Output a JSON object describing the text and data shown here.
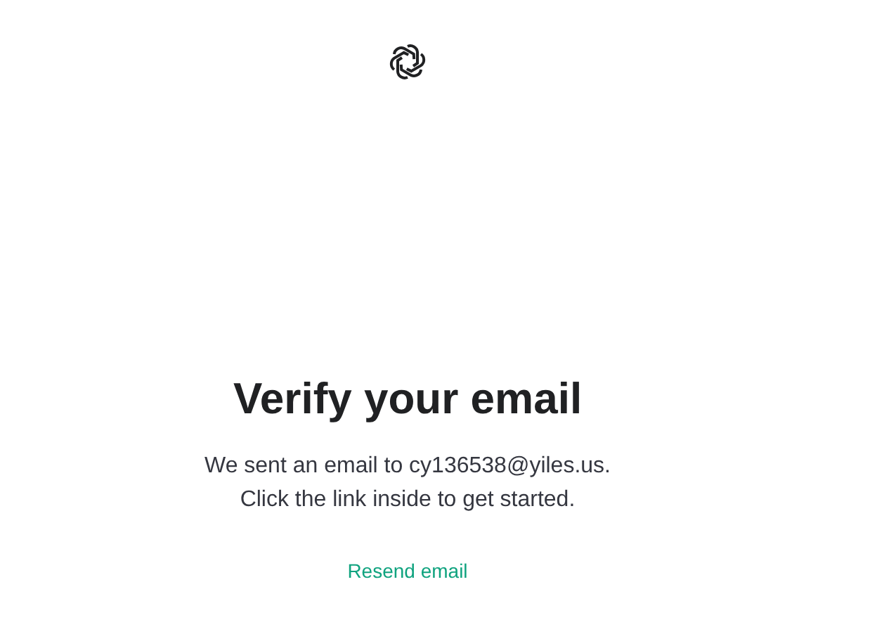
{
  "title": "Verify your email",
  "message": [
    "We sent an email to cy136538@yiles.us.",
    "Click the link inside to get started."
  ],
  "resend_link": "Resend email"
}
